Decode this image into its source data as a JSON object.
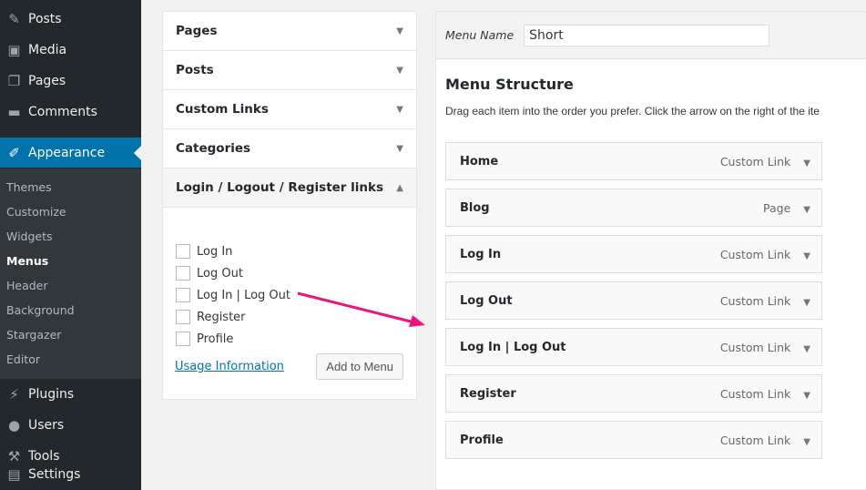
{
  "sidebar": {
    "items": [
      {
        "label": "Posts",
        "icon": "pin-icon"
      },
      {
        "label": "Media",
        "icon": "media-icon"
      },
      {
        "label": "Pages",
        "icon": "pages-icon"
      },
      {
        "label": "Comments",
        "icon": "comment-icon"
      },
      {
        "label": "Appearance",
        "icon": "brush-icon"
      },
      {
        "label": "Plugins",
        "icon": "plug-icon"
      },
      {
        "label": "Users",
        "icon": "user-icon"
      },
      {
        "label": "Tools",
        "icon": "wrench-icon"
      },
      {
        "label": "Settings",
        "icon": "settings-icon"
      }
    ],
    "submenu": [
      "Themes",
      "Customize",
      "Widgets",
      "Menus",
      "Header",
      "Background",
      "Stargazer",
      "Editor"
    ]
  },
  "left": {
    "sections": [
      "Pages",
      "Posts",
      "Custom Links",
      "Categories",
      "Login / Logout / Register links"
    ],
    "checkboxes": [
      "Log In",
      "Log Out",
      "Log In | Log Out",
      "Register",
      "Profile"
    ],
    "usage_link": "Usage Information",
    "add_button": "Add to Menu"
  },
  "right": {
    "menu_name_label": "Menu Name",
    "menu_name_value": "Short",
    "title": "Menu Structure",
    "desc": "Drag each item into the order you prefer. Click the arrow on the right of the ite",
    "items": [
      {
        "title": "Home",
        "type": "Custom Link"
      },
      {
        "title": "Blog",
        "type": "Page"
      },
      {
        "title": "Log In",
        "type": "Custom Link"
      },
      {
        "title": "Log Out",
        "type": "Custom Link"
      },
      {
        "title": "Log In | Log Out",
        "type": "Custom Link"
      },
      {
        "title": "Register",
        "type": "Custom Link"
      },
      {
        "title": "Profile",
        "type": "Custom Link"
      }
    ]
  },
  "colors": {
    "accent": "#0073aa",
    "arrow": "#f0127e"
  }
}
